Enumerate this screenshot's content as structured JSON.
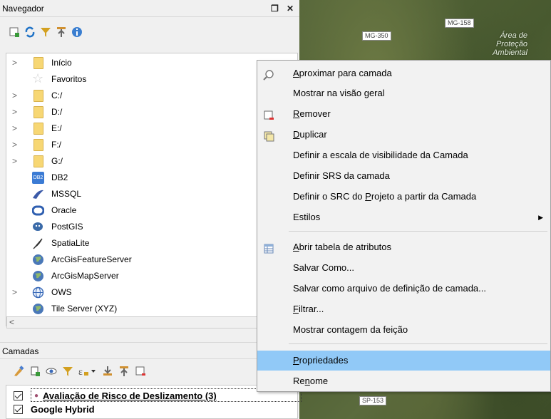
{
  "map": {
    "road1": "MG-158",
    "road2": "MG-350",
    "road3": "SP-153",
    "area_text": "Área de Proteção Ambiental"
  },
  "navigator": {
    "title": "Navegador",
    "items": [
      {
        "label": "Início",
        "expandable": true,
        "icon": "folder"
      },
      {
        "label": "Favoritos",
        "expandable": false,
        "icon": "star"
      },
      {
        "label": "C:/",
        "expandable": true,
        "icon": "folder"
      },
      {
        "label": "D:/",
        "expandable": true,
        "icon": "folder"
      },
      {
        "label": "E:/",
        "expandable": true,
        "icon": "folder"
      },
      {
        "label": "F:/",
        "expandable": true,
        "icon": "folder"
      },
      {
        "label": "G:/",
        "expandable": true,
        "icon": "folder"
      },
      {
        "label": "DB2",
        "expandable": false,
        "icon": "db2"
      },
      {
        "label": "MSSQL",
        "expandable": false,
        "icon": "mssql"
      },
      {
        "label": "Oracle",
        "expandable": false,
        "icon": "oracle"
      },
      {
        "label": "PostGIS",
        "expandable": false,
        "icon": "postgis"
      },
      {
        "label": "SpatiaLite",
        "expandable": false,
        "icon": "feather"
      },
      {
        "label": "ArcGisFeatureServer",
        "expandable": false,
        "icon": "globe"
      },
      {
        "label": "ArcGisMapServer",
        "expandable": false,
        "icon": "globe"
      },
      {
        "label": "OWS",
        "expandable": true,
        "icon": "globe-outline"
      },
      {
        "label": "Tile Server (XYZ)",
        "expandable": false,
        "icon": "globe"
      }
    ],
    "db2_badge": "DB2"
  },
  "layers": {
    "title": "Camadas",
    "items": [
      {
        "label": "Avaliação de Risco de Deslizamento (3)",
        "checked": true,
        "bold": true,
        "underline": true
      },
      {
        "label": "Google Hybrid",
        "checked": true,
        "bold": true,
        "underline": false
      }
    ]
  },
  "context_menu": {
    "items": [
      {
        "pre": "",
        "u": "A",
        "post": "proximar para camada",
        "icon": "zoom-layer"
      },
      {
        "pre": "Mostrar na ",
        "u": "",
        "post": "visão geral",
        "icon": ""
      },
      {
        "pre": "",
        "u": "R",
        "post": "emover",
        "icon": "remove-layer"
      },
      {
        "pre": "",
        "u": "D",
        "post": "uplicar",
        "icon": "duplicate-layer"
      },
      {
        "pre": "Definir a escala de visibilidade da Camada",
        "u": "",
        "post": "",
        "icon": ""
      },
      {
        "pre": "Definir SRS da camada",
        "u": "",
        "post": "",
        "icon": ""
      },
      {
        "pre": "Definir o SRC do ",
        "u": "P",
        "post": "rojeto a partir da Camada",
        "icon": ""
      },
      {
        "pre": "Estilos",
        "u": "",
        "post": "",
        "icon": "",
        "submenu": true
      },
      {
        "pre": "",
        "u": "A",
        "post": "brir tabela de atributos",
        "icon": "attribute-table"
      },
      {
        "pre": "Salvar Como...",
        "u": "",
        "post": "",
        "icon": ""
      },
      {
        "pre": "Salvar como arquivo de definição de camada...",
        "u": "",
        "post": "",
        "icon": ""
      },
      {
        "pre": "",
        "u": "F",
        "post": "iltrar...",
        "icon": ""
      },
      {
        "pre": "Mostrar contagem da feição",
        "u": "",
        "post": "",
        "icon": ""
      },
      {
        "pre": "",
        "u": "P",
        "post": "ropriedades",
        "icon": "",
        "highlighted": true
      },
      {
        "pre": "Re",
        "u": "n",
        "post": "ome",
        "icon": ""
      }
    ],
    "submenu_arrow": "▶"
  },
  "colors": {
    "highlight": "#91c9f7",
    "folder": "#f7d774"
  }
}
